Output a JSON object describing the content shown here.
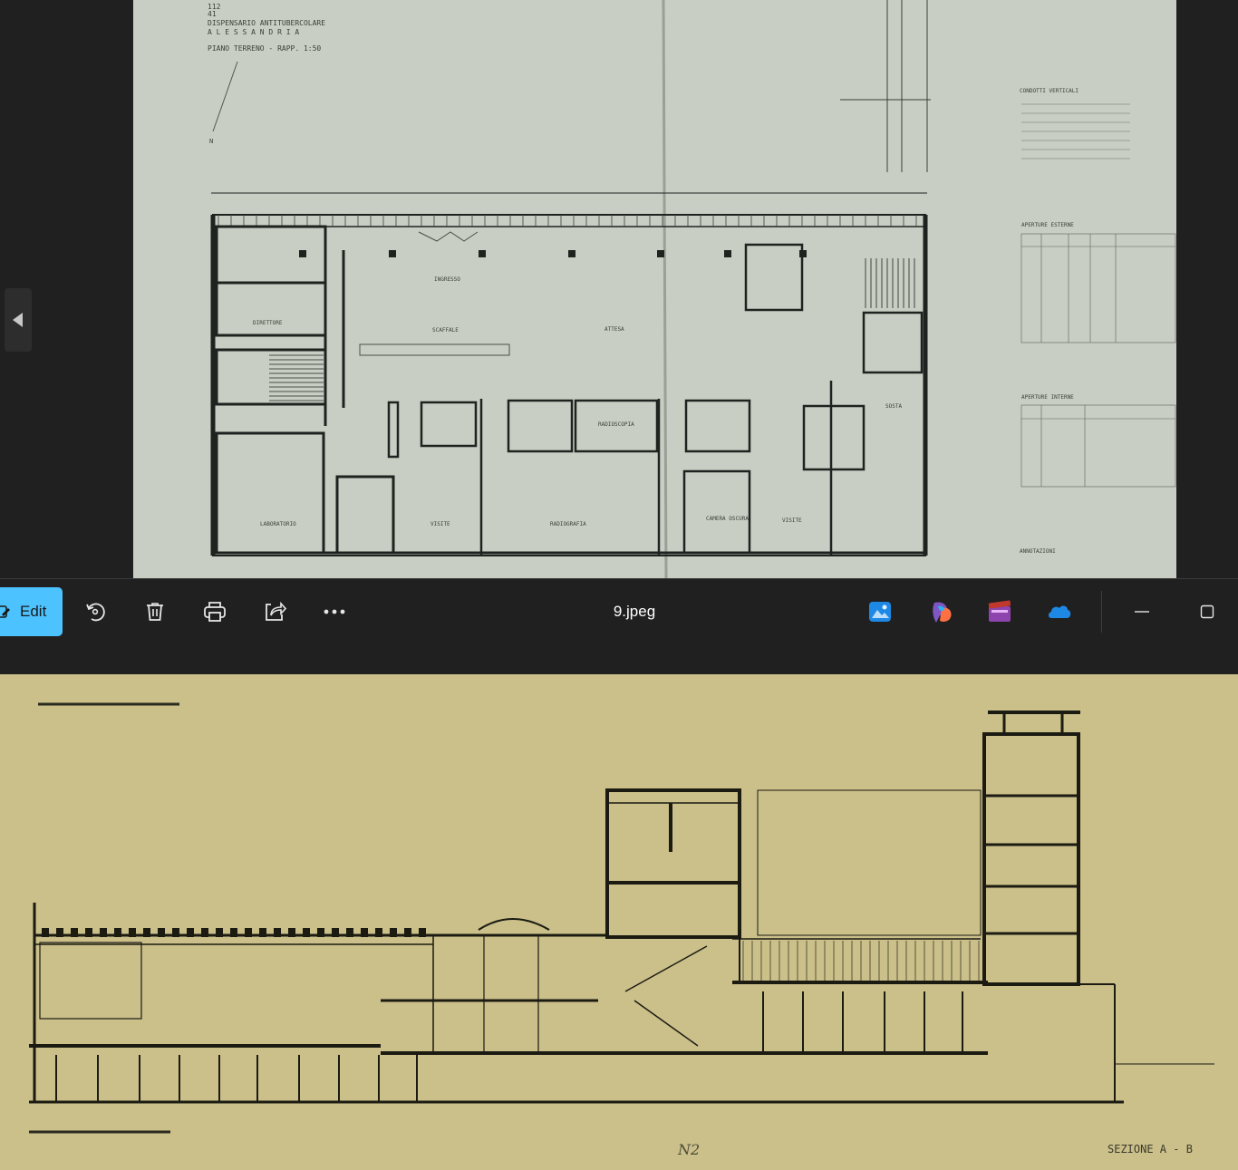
{
  "viewer": {
    "plan_labels": {
      "number_top": "112",
      "number_bottom": "41",
      "title_line1": "DISPENSARIO ANTITUBERCOLARE",
      "title_line2": "A L E S S A N D R I A",
      "title_line3": "PIANO TERRENO - RAPP. 1:50",
      "north": "N",
      "ingresso": "INGRESSO",
      "attesa": "ATTESA",
      "scaffale": "SCAFFALE",
      "radioscopia": "RADIOSCOPIA",
      "radiografia": "RADIOGRAFIA",
      "laboratorio": "LABORATORIO",
      "visite_left": "VISITE",
      "visite_right": "VISITE",
      "camera_oscura": "CAMERA OSCURA",
      "sosta": "SOSTA",
      "direttore": "DIRETTORE",
      "aperture_esterne": "APERTURE ESTERNE",
      "aperture_interne": "APERTURE INTERNE",
      "condotti_verticali": "CONDOTTI VERTICALI",
      "annotazioni": "ANNOTAZIONI"
    }
  },
  "toolbar": {
    "edit_label": "Edit",
    "filename": "9.jpeg",
    "buttons": [
      "rotate-icon",
      "delete-icon",
      "print-icon",
      "share-icon",
      "more-icon"
    ],
    "apps": [
      "photos-app-icon",
      "copilot-app-icon",
      "clipchamp-app-icon",
      "onedrive-app-icon"
    ],
    "window_controls": [
      "minimize-icon",
      "maximize-icon"
    ],
    "accent_color": "#4cc2ff"
  },
  "section": {
    "label_section": "SEZIONE A - B",
    "label_n": "N2"
  }
}
